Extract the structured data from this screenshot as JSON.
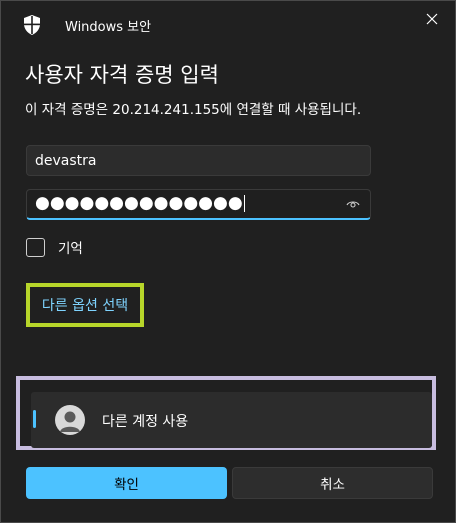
{
  "window": {
    "app_title": "Windows 보안",
    "icon": "shield-icon"
  },
  "dialog": {
    "heading": "사용자 자격 증명 입력",
    "subtitle": "이 자격 증명은 20.214.241.155에 연결할 때 사용됩니다."
  },
  "form": {
    "username": {
      "value": "devastra"
    },
    "password": {
      "masked_value": "●●●●●●●●●●●●●●"
    },
    "remember": {
      "label": "기억",
      "checked": false
    }
  },
  "more_choices": {
    "label": "다른 옵션 선택",
    "highlight_color": "#b7d62a"
  },
  "account_option": {
    "label": "다른 계정 사용",
    "icon": "avatar-icon",
    "frame_color": "#c8bde0"
  },
  "buttons": {
    "ok_label": "확인",
    "cancel_label": "취소"
  },
  "colors": {
    "accent": "#4cc2ff",
    "link": "#7fd4ff",
    "background": "#202020"
  }
}
